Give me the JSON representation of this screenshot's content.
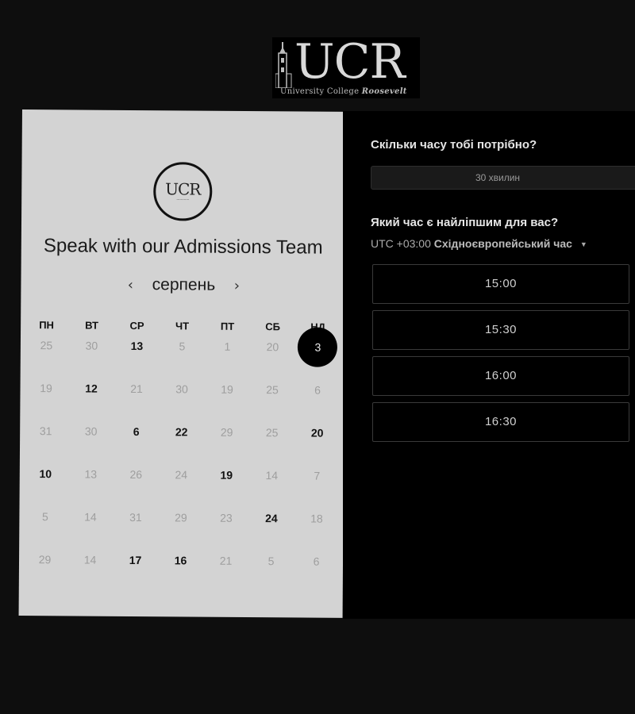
{
  "header": {
    "logo_mark": "UCR",
    "logo_tagline_prefix": "University College",
    "logo_tagline_suffix": "Roosevelt"
  },
  "left": {
    "badge_mark": "UCR",
    "title": "Speak with our Admissions Team",
    "month": "серпень",
    "prev_icon": "chevron-left-icon",
    "next_icon": "chevron-right-icon",
    "weekdays": [
      "ПН",
      "ВТ",
      "СР",
      "ЧТ",
      "ПТ",
      "СБ",
      "НД"
    ],
    "weeks": [
      [
        {
          "d": "25",
          "a": false
        },
        {
          "d": "30",
          "a": false
        },
        {
          "d": "13",
          "a": true
        },
        {
          "d": "5",
          "a": false
        },
        {
          "d": "1",
          "a": false
        },
        {
          "d": "20",
          "a": false
        },
        {
          "d": "3",
          "a": true,
          "s": true
        }
      ],
      [
        {
          "d": "19",
          "a": false
        },
        {
          "d": "12",
          "a": true
        },
        {
          "d": "21",
          "a": false
        },
        {
          "d": "30",
          "a": false
        },
        {
          "d": "19",
          "a": false
        },
        {
          "d": "25",
          "a": false
        },
        {
          "d": "6",
          "a": false
        }
      ],
      [
        {
          "d": "31",
          "a": false
        },
        {
          "d": "30",
          "a": false
        },
        {
          "d": "6",
          "a": true
        },
        {
          "d": "22",
          "a": true
        },
        {
          "d": "29",
          "a": false
        },
        {
          "d": "25",
          "a": false
        },
        {
          "d": "20",
          "a": true
        }
      ],
      [
        {
          "d": "10",
          "a": true
        },
        {
          "d": "13",
          "a": false
        },
        {
          "d": "26",
          "a": false
        },
        {
          "d": "24",
          "a": false
        },
        {
          "d": "19",
          "a": true
        },
        {
          "d": "14",
          "a": false
        },
        {
          "d": "7",
          "a": false
        }
      ],
      [
        {
          "d": "5",
          "a": false
        },
        {
          "d": "14",
          "a": false
        },
        {
          "d": "31",
          "a": false
        },
        {
          "d": "29",
          "a": false
        },
        {
          "d": "23",
          "a": false
        },
        {
          "d": "24",
          "a": true
        },
        {
          "d": "18",
          "a": false
        }
      ],
      [
        {
          "d": "29",
          "a": false
        },
        {
          "d": "14",
          "a": false
        },
        {
          "d": "17",
          "a": true
        },
        {
          "d": "16",
          "a": true
        },
        {
          "d": "21",
          "a": false
        },
        {
          "d": "5",
          "a": false
        },
        {
          "d": "6",
          "a": false
        }
      ]
    ]
  },
  "right": {
    "duration_question": "Скільки часу тобі потрібно?",
    "duration_value": "30 хвилин",
    "time_question": "Який час є найліпшим для вас?",
    "timezone_offset": "UTC +03:00",
    "timezone_name": "Східноєвропейський час",
    "slots": [
      "15:00",
      "15:30",
      "16:00",
      "16:30"
    ]
  }
}
